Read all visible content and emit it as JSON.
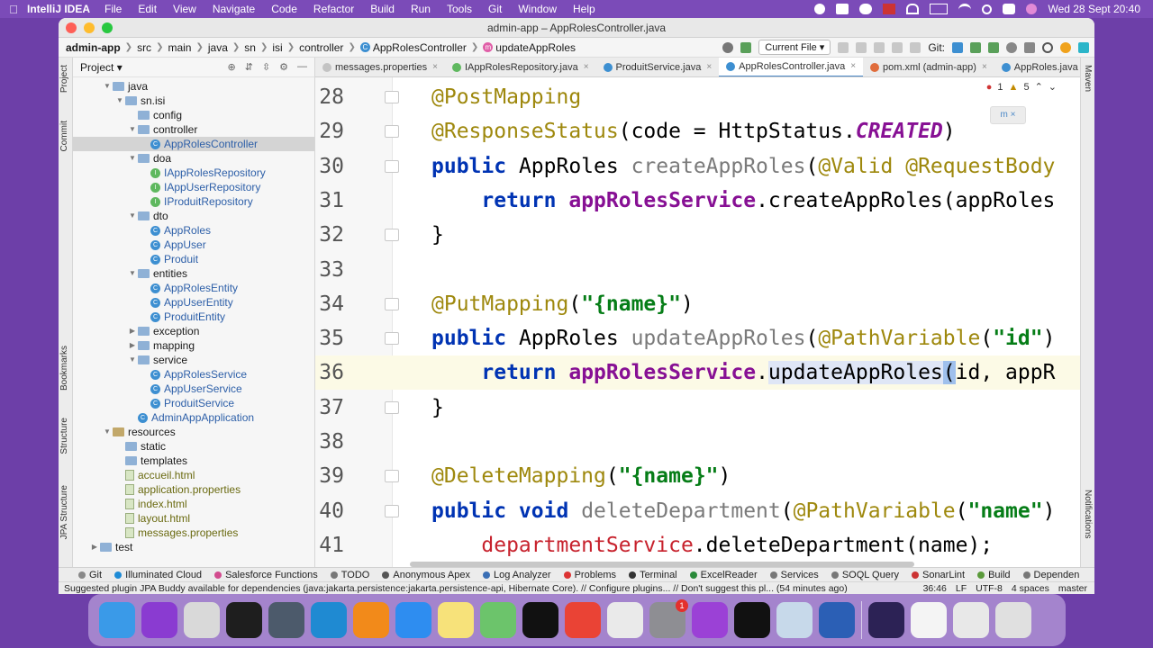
{
  "menubar": {
    "app_name": "IntelliJ IDEA",
    "items": [
      "File",
      "Edit",
      "View",
      "Navigate",
      "Code",
      "Refactor",
      "Build",
      "Run",
      "Tools",
      "Git",
      "Window",
      "Help"
    ],
    "clock": "Wed 28 Sept  20:40"
  },
  "window": {
    "title": "admin-app – AppRolesController.java"
  },
  "navbar": {
    "crumbs": [
      "admin-app",
      "src",
      "main",
      "java",
      "sn",
      "isi",
      "controller",
      "AppRolesController",
      "updateAppRoles"
    ],
    "current_file": "Current File",
    "git_label": "Git:"
  },
  "left_strip": [
    "Project",
    "Commit",
    "Bookmarks",
    "Structure",
    "JPA Structure"
  ],
  "right_strip": [
    "Maven",
    "Notifications"
  ],
  "project": {
    "title": "Project",
    "tree": [
      {
        "label": "java",
        "kind": "folder",
        "depth": 3,
        "open": true
      },
      {
        "label": "sn.isi",
        "kind": "folder",
        "depth": 4,
        "open": true
      },
      {
        "label": "config",
        "kind": "folder",
        "depth": 5
      },
      {
        "label": "controller",
        "kind": "folder",
        "depth": 5,
        "open": true
      },
      {
        "label": "AppRolesController",
        "kind": "class",
        "depth": 6,
        "selected": true
      },
      {
        "label": "doa",
        "kind": "folder",
        "depth": 5,
        "open": true
      },
      {
        "label": "IAppRolesRepository",
        "kind": "iface",
        "depth": 6
      },
      {
        "label": "IAppUserRepository",
        "kind": "iface",
        "depth": 6
      },
      {
        "label": "IProduitRepository",
        "kind": "iface",
        "depth": 6
      },
      {
        "label": "dto",
        "kind": "folder",
        "depth": 5,
        "open": true
      },
      {
        "label": "AppRoles",
        "kind": "class",
        "depth": 6
      },
      {
        "label": "AppUser",
        "kind": "class",
        "depth": 6
      },
      {
        "label": "Produit",
        "kind": "class",
        "depth": 6
      },
      {
        "label": "entities",
        "kind": "folder",
        "depth": 5,
        "open": true
      },
      {
        "label": "AppRolesEntity",
        "kind": "class",
        "depth": 6
      },
      {
        "label": "AppUserEntity",
        "kind": "class",
        "depth": 6
      },
      {
        "label": "ProduitEntity",
        "kind": "class",
        "depth": 6
      },
      {
        "label": "exception",
        "kind": "folder",
        "depth": 5,
        "closed": true
      },
      {
        "label": "mapping",
        "kind": "folder",
        "depth": 5,
        "closed": true
      },
      {
        "label": "service",
        "kind": "folder",
        "depth": 5,
        "open": true
      },
      {
        "label": "AppRolesService",
        "kind": "class",
        "depth": 6
      },
      {
        "label": "AppUserService",
        "kind": "class",
        "depth": 6
      },
      {
        "label": "ProduitService",
        "kind": "class",
        "depth": 6
      },
      {
        "label": "AdminAppApplication",
        "kind": "class",
        "depth": 5
      },
      {
        "label": "resources",
        "kind": "folder-res",
        "depth": 3,
        "open": true
      },
      {
        "label": "static",
        "kind": "folder",
        "depth": 4
      },
      {
        "label": "templates",
        "kind": "folder",
        "depth": 4
      },
      {
        "label": "accueil.html",
        "kind": "file",
        "depth": 4,
        "color": "olive"
      },
      {
        "label": "application.properties",
        "kind": "file",
        "depth": 4,
        "color": "olive"
      },
      {
        "label": "index.html",
        "kind": "file",
        "depth": 4,
        "color": "olive"
      },
      {
        "label": "layout.html",
        "kind": "file",
        "depth": 4,
        "color": "olive"
      },
      {
        "label": "messages.properties",
        "kind": "file",
        "depth": 4,
        "color": "olive"
      },
      {
        "label": "test",
        "kind": "folder",
        "depth": 2,
        "closed": true
      }
    ]
  },
  "tabs": [
    {
      "label": "messages.properties",
      "icon": "p"
    },
    {
      "label": "IAppRolesRepository.java",
      "icon": "i"
    },
    {
      "label": "ProduitService.java",
      "icon": "c"
    },
    {
      "label": "AppRolesController.java",
      "icon": "c",
      "active": true
    },
    {
      "label": "pom.xml (admin-app)",
      "icon": "m"
    },
    {
      "label": "AppRoles.java",
      "icon": "c"
    }
  ],
  "editor": {
    "error_count": "1",
    "warning_count": "5",
    "lines": [
      {
        "n": "28",
        "html": "<span class='ann'>@PostMapping</span>"
      },
      {
        "n": "29",
        "html": "<span class='ann'>@ResponseStatus</span>(code = HttpStatus.<span class='ital'>CREATED</span>)"
      },
      {
        "n": "30",
        "html": "<span class='kw'>public</span> AppRoles <span class='gray'>createAppRoles</span>(<span class='ann'>@Valid @RequestBody</span>"
      },
      {
        "n": "31",
        "html": "    <span class='kw'>return</span> <span class='fld'>appRolesService</span>.createAppRoles(appRoles"
      },
      {
        "n": "32",
        "html": "}"
      },
      {
        "n": "33",
        "html": ""
      },
      {
        "n": "34",
        "html": "<span class='ann'>@PutMapping</span>(<span class='str'>\"{name}\"</span>)"
      },
      {
        "n": "35",
        "html": "<span class='kw'>public</span> AppRoles <span class='gray'>updateAppRoles</span>(<span class='ann'>@PathVariable</span>(<span class='str'>\"id\"</span>)"
      },
      {
        "n": "36",
        "html": "    <span class='kw'>return</span> <span class='fld'>appRolesService</span>.<span class='hl'>updateAppRoles</span><span class='caret'>(</span>id, appR",
        "current": true
      },
      {
        "n": "37",
        "html": "}"
      },
      {
        "n": "38",
        "html": ""
      },
      {
        "n": "39",
        "html": "<span class='ann'>@DeleteMapping</span>(<span class='str'>\"{name}\"</span>)"
      },
      {
        "n": "40",
        "html": "<span class='kw'>public void</span> <span class='gray'>deleteDepartment</span>(<span class='ann'>@PathVariable</span>(<span class='str'>\"name\"</span>)"
      },
      {
        "n": "41",
        "html": "    <span class='red'>departmentService</span>.deleteDepartment(name);"
      }
    ]
  },
  "tool_windows": [
    "Git",
    "Illuminated Cloud",
    "Salesforce Functions",
    "TODO",
    "Anonymous Apex",
    "Log Analyzer",
    "Problems",
    "Terminal",
    "ExcelReader",
    "Services",
    "SOQL Query",
    "SonarLint",
    "Build",
    "Dependen"
  ],
  "status": {
    "message": "Suggested plugin JPA Buddy available for dependencies (java:jakarta.persistence:jakarta.persistence-api, Hibernate Core). // Configure plugins... // Don't suggest this pl... (54 minutes ago)",
    "position": "36:46",
    "line_sep": "LF",
    "encoding": "UTF-8",
    "indent": "4 spaces",
    "branch": "master"
  },
  "dock": {
    "icons": [
      {
        "name": "finder-icon",
        "color": "#3a9ae8"
      },
      {
        "name": "siri-icon",
        "color": "#8a3bd1"
      },
      {
        "name": "launchpad-icon",
        "color": "#d9d9d9"
      },
      {
        "name": "terminal-icon",
        "color": "#1e1e1e"
      },
      {
        "name": "quicktime-icon",
        "color": "#4c5a6b"
      },
      {
        "name": "vscode-icon",
        "color": "#1f8ad2"
      },
      {
        "name": "vlc-icon",
        "color": "#f28a1a"
      },
      {
        "name": "safari-icon",
        "color": "#2e8df0"
      },
      {
        "name": "notes-icon",
        "color": "#f7e27a"
      },
      {
        "name": "maps-icon",
        "color": "#6cc46b"
      },
      {
        "name": "intellij-icon",
        "color": "#111111"
      },
      {
        "name": "chrome-icon",
        "color": "#ea4335"
      },
      {
        "name": "screenshot-icon",
        "color": "#eaeaea"
      },
      {
        "name": "system-preferences-icon",
        "color": "#8e8e93",
        "badge": "1"
      },
      {
        "name": "podcasts-icon",
        "color": "#9b41d6"
      },
      {
        "name": "apple-tv-icon",
        "color": "#111111"
      },
      {
        "name": "preview-icon",
        "color": "#c7d9ea"
      },
      {
        "name": "word-icon",
        "color": "#2b5fb5"
      },
      {
        "name": "eclipse-icon",
        "color": "#2c2255"
      },
      {
        "name": "document-icon",
        "color": "#f4f4f4"
      },
      {
        "name": "downloads-icon",
        "color": "#e8e8e8"
      },
      {
        "name": "trash-icon",
        "color": "#e0e0e0"
      }
    ]
  }
}
